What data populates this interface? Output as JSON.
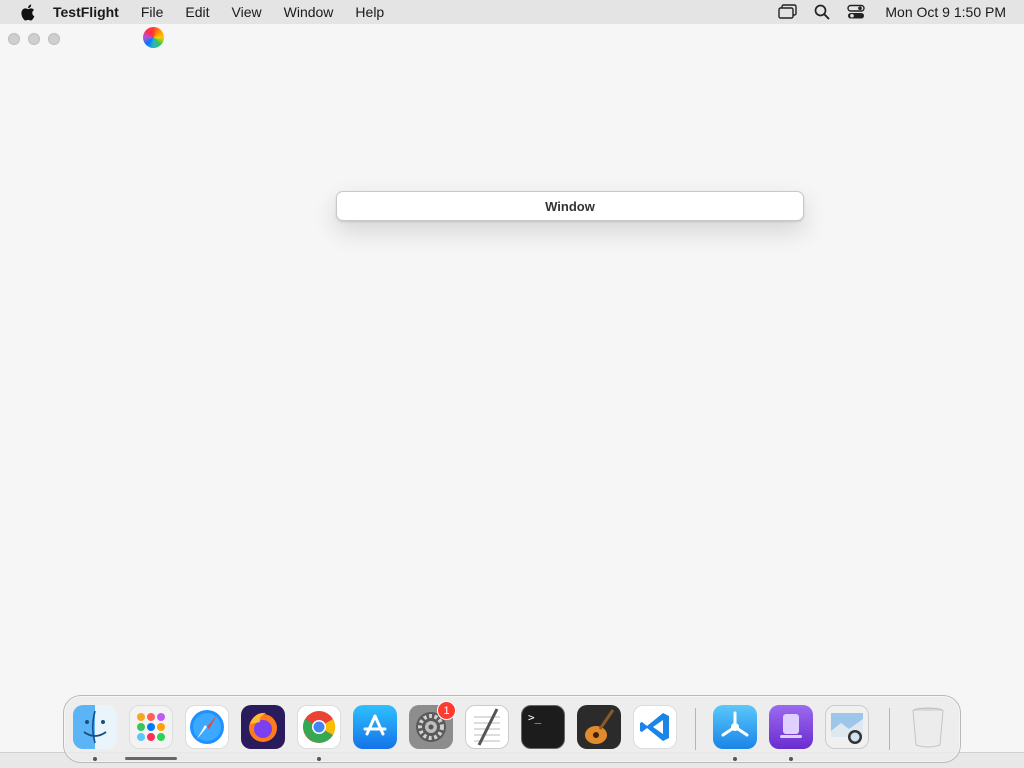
{
  "menubar": {
    "app_name": "TestFlight",
    "menus": [
      "File",
      "Edit",
      "View",
      "Window",
      "Help"
    ],
    "clock": "Mon Oct 9  1:50 PM",
    "status_icons": [
      "screen-mirroring-icon",
      "spotlight-search-icon",
      "control-center-icon"
    ]
  },
  "window": {
    "button_label": "Window"
  },
  "dock": {
    "apps": [
      {
        "name": "Finder",
        "icon": "finder-icon",
        "running": true
      },
      {
        "name": "Launchpad",
        "icon": "launchpad-icon",
        "running": false
      },
      {
        "name": "Safari",
        "icon": "safari-icon",
        "running": false
      },
      {
        "name": "Firefox",
        "icon": "firefox-icon",
        "running": false
      },
      {
        "name": "Google Chrome",
        "icon": "chrome-icon",
        "running": true
      },
      {
        "name": "App Store",
        "icon": "app-store-icon",
        "running": false
      },
      {
        "name": "System Settings",
        "icon": "system-settings-icon",
        "running": false,
        "badge": "1"
      },
      {
        "name": "TextEdit",
        "icon": "textedit-icon",
        "running": false
      },
      {
        "name": "Terminal",
        "icon": "terminal-icon",
        "running": false
      },
      {
        "name": "GarageBand",
        "icon": "garageband-icon",
        "running": false
      },
      {
        "name": "Visual Studio Code",
        "icon": "vscode-icon",
        "running": false
      },
      {
        "name": "TestFlight",
        "icon": "testflight-icon",
        "running": true
      },
      {
        "name": "Apple Configurator",
        "icon": "configurator-icon",
        "running": true
      },
      {
        "name": "Preview",
        "icon": "preview-icon",
        "running": false
      },
      {
        "name": "Trash",
        "icon": "trash-icon",
        "running": false
      }
    ],
    "system_settings_badge": "1",
    "terminal_prompt": ">_"
  },
  "colors": {
    "menubar_bg": "#e4e4e4",
    "window_bg": "#f6f6f6",
    "badge_red": "#ff3b30",
    "accent_blue": "#1a84e8"
  }
}
